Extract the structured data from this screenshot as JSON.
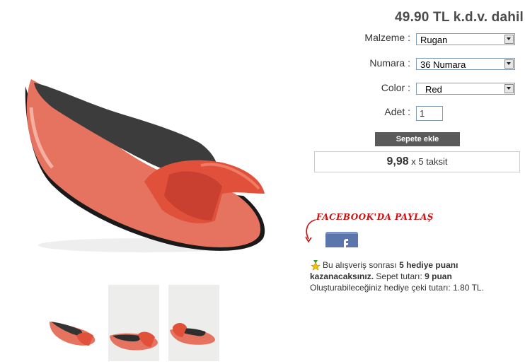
{
  "product": {
    "price": "49.90 TL k.d.v. dahil",
    "options": {
      "material_label": "Malzeme :",
      "material_value": "Rugan",
      "size_label": "Numara :",
      "size_value": "36 Numara",
      "color_label": "Color :",
      "color_value": "Red",
      "quantity_label": "Adet :",
      "quantity_value": "1"
    },
    "add_to_cart_label": "Sepete ekle",
    "installment": {
      "amount": "9,98",
      "text": "x 5 taksit"
    }
  },
  "share": {
    "facebook_label": "FACEBOOK'DA PAYLAŞ"
  },
  "points": {
    "line1_prefix": "Bu alışveriş sonrası",
    "points_bold": "5 hediye puanı kazanacaksınız.",
    "cart_total_label": "Sepet tutarı:",
    "cart_total_value": "9 puan",
    "gift_text": "Oluşturabileceğiniz hediye çeki tutarı: 1.80 TL."
  },
  "colors": {
    "shoe": "#e5735f",
    "bow": "#e0503a",
    "button_bg": "#5a5a5a",
    "facebook": "#5b76ad",
    "facebook_label": "#cc1010"
  }
}
